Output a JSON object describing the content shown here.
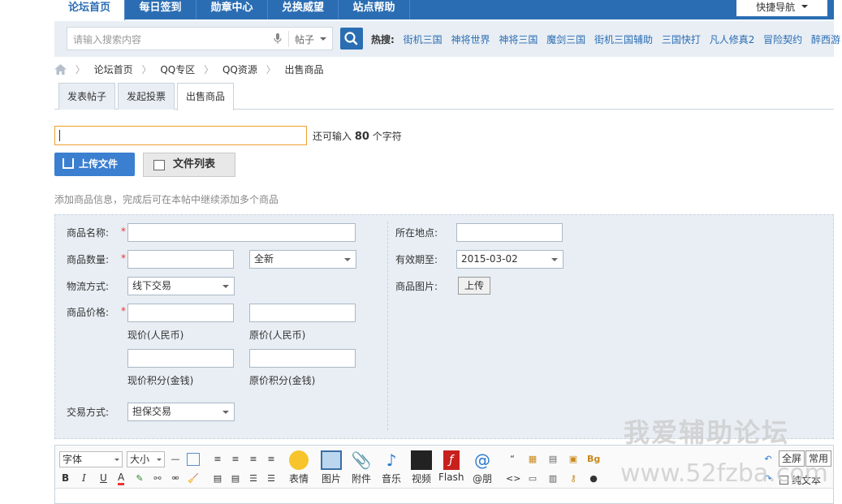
{
  "topnav": {
    "tabs": [
      "论坛首页",
      "每日签到",
      "勋章中心",
      "兑换威望",
      "站点帮助"
    ],
    "quick_nav": "快捷导航"
  },
  "search": {
    "placeholder": "请输入搜索内容",
    "type": "帖子",
    "hot_label": "热搜:",
    "hot_terms": [
      "街机三国",
      "神将世界",
      "神将三国",
      "魔剑三国",
      "街机三国辅助",
      "三国快打",
      "凡人修真2",
      "冒险契约",
      "醉西游"
    ]
  },
  "breadcrumb": [
    "论坛首页",
    "QQ专区",
    "QQ资源",
    "出售商品"
  ],
  "post_tabs": [
    "发表帖子",
    "发起投票",
    "出售商品"
  ],
  "subject": {
    "value": "",
    "hint_prefix": "还可输入",
    "hint_count": "80",
    "hint_suffix": "个字符"
  },
  "buttons": {
    "upload": "上传文件",
    "file_list": "文件列表"
  },
  "note": "添加商品信息，完成后可在本帖中继续添加多个商品",
  "goods_form": {
    "name_label": "商品名称:",
    "qty_label": "商品数量:",
    "condition": "全新",
    "shipping_label": "物流方式:",
    "shipping_value": "线下交易",
    "price_label": "商品价格:",
    "price_now": "现价(人民币)",
    "price_orig": "原价(人民币)",
    "credit_now": "现价积分(金钱)",
    "credit_orig": "原价积分(金钱)",
    "trade_label": "交易方式:",
    "trade_value": "担保交易",
    "location_label": "所在地点:",
    "expire_label": "有效期至:",
    "expire_value": "2015-03-02",
    "image_label": "商品图片:",
    "image_upload": "上传",
    "required_mark": "*"
  },
  "editor": {
    "font": "字体",
    "size": "大小",
    "big_buttons": [
      "表情",
      "图片",
      "附件",
      "音乐",
      "视频",
      "Flash",
      "@朋"
    ],
    "fullscreen": "全屏",
    "common": "常用",
    "plain_text": "纯文本"
  },
  "watermark": {
    "line1": "我爱辅助论坛",
    "line2": "www.52fzba.com"
  }
}
